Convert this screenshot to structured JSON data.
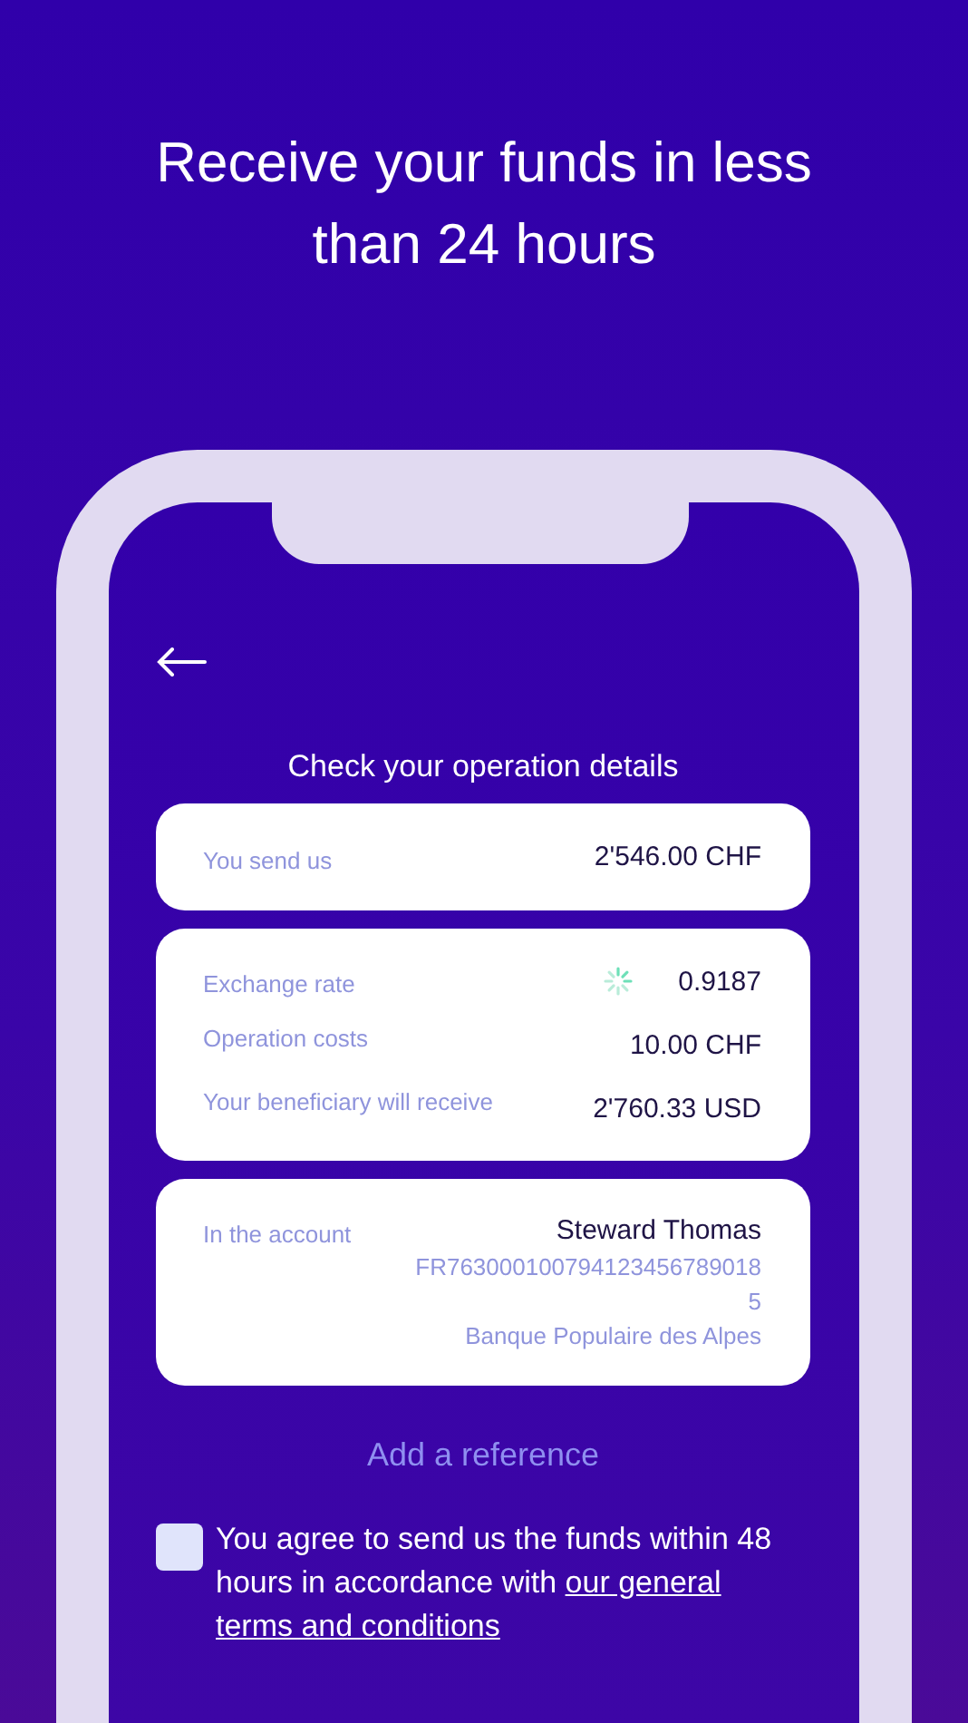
{
  "headline": "Receive your funds in less than 24 hours",
  "screen": {
    "title": "Check your operation details",
    "send": {
      "label": "You send us",
      "value": "2'546.00 CHF"
    },
    "details": [
      {
        "kind": "rate",
        "label": "Exchange rate",
        "value": "0.9187"
      },
      {
        "kind": "plain",
        "label": "Operation costs",
        "value": "10.00 CHF"
      },
      {
        "kind": "plain",
        "label": "Your beneficiary will receive",
        "value": "2'760.33 USD"
      }
    ],
    "account": {
      "label": "In the account",
      "name": "Steward Thomas",
      "iban": [
        "FR763000100794123456789018",
        "5"
      ],
      "bank": "Banque Populaire des Alpes"
    },
    "add_reference": "Add a reference",
    "agreement": {
      "checked": false,
      "text": "You agree to send us the funds within 48 hours in accordance with ",
      "link": [
        "our general",
        "terms and conditions"
      ]
    }
  }
}
